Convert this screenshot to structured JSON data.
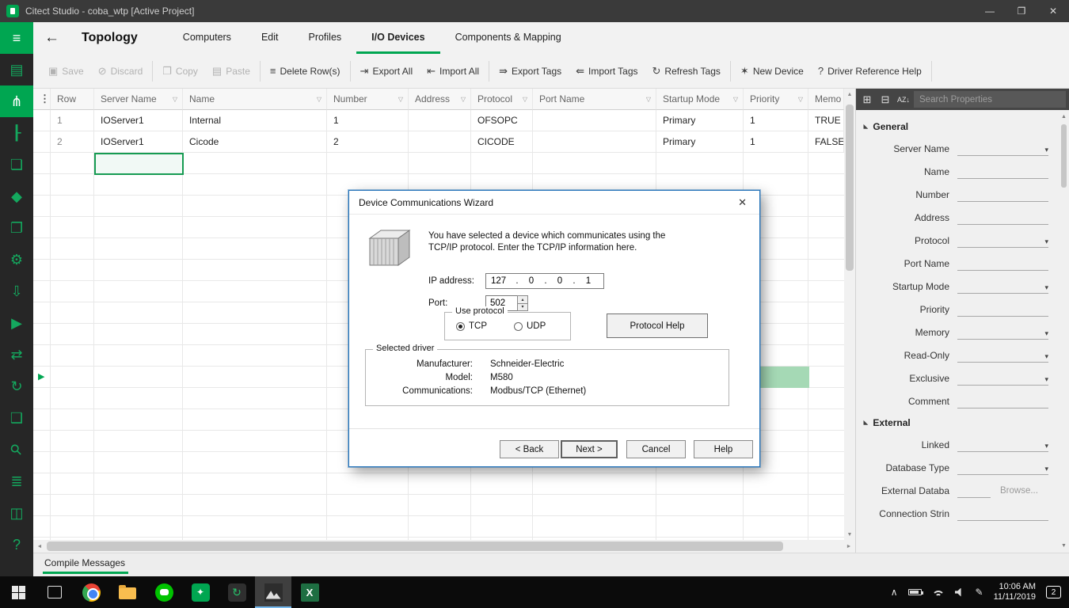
{
  "window": {
    "title": "Citect Studio - coba_wtp [Active Project]"
  },
  "nav": {
    "title": "Topology",
    "tabs": [
      "Computers",
      "Edit",
      "Profiles",
      "I/O Devices",
      "Components & Mapping"
    ]
  },
  "toolbar": {
    "items": [
      "Save",
      "Discard",
      "Copy",
      "Paste",
      "Delete Row(s)",
      "Export All",
      "Import All",
      "Export Tags",
      "Import Tags",
      "Refresh Tags",
      "New Device",
      "Driver Reference Help"
    ]
  },
  "table": {
    "headers": [
      "Row",
      "Server Name",
      "Name",
      "Number",
      "Address",
      "Protocol",
      "Port Name",
      "Startup Mode",
      "Priority",
      "Memo"
    ],
    "rows": [
      [
        "1",
        "IOServer1",
        "Internal",
        "1",
        "",
        "OFSOPC",
        "",
        "Primary",
        "1",
        "TRUE"
      ],
      [
        "2",
        "IOServer1",
        "Cicode",
        "2",
        "",
        "CICODE",
        "",
        "Primary",
        "1",
        "FALSE"
      ]
    ]
  },
  "properties": {
    "search_placeholder": "Search Properties",
    "general_title": "General",
    "general_fields": [
      "Server Name",
      "Name",
      "Number",
      "Address",
      "Protocol",
      "Port Name",
      "Startup Mode",
      "Priority",
      "Memory",
      "Read-Only",
      "Exclusive",
      "Comment"
    ],
    "external_title": "External",
    "external_fields": [
      "Linked",
      "Database Type",
      "External Databa",
      "Connection Strin"
    ],
    "browse_label": "Browse..."
  },
  "dialog": {
    "title": "Device Communications Wizard",
    "message_1": "You have selected a device which communicates using the",
    "message_2": "TCP/IP protocol. Enter the TCP/IP information here.",
    "ip_label": "IP address:",
    "ip_parts": [
      "127",
      "0",
      "0",
      "1"
    ],
    "ip_separator": ".",
    "port_label": "Port:",
    "port_value": "502",
    "protocol_group": "Use protocol",
    "tcp_label": "TCP",
    "udp_label": "UDP",
    "protocol_help": "Protocol Help",
    "driver_group": "Selected driver",
    "manufacturer_label": "Manufacturer:",
    "manufacturer_value": "Schneider-Electric",
    "model_label": "Model:",
    "model_value": "M580",
    "communications_label": "Communications:",
    "communications_value": "Modbus/TCP (Ethernet)",
    "back": "< Back",
    "next": "Next >",
    "cancel": "Cancel",
    "help": "Help"
  },
  "statusbar": {
    "tab": "Compile Messages"
  },
  "taskbar": {
    "time": "10:06 AM",
    "date": "11/11/2019",
    "badge": "2"
  },
  "icons": {
    "menu": "≡",
    "stack": "▤",
    "topology": "⋔",
    "tree": "┠",
    "monitor": "❏",
    "shield": "◆",
    "documents": "❐",
    "gear": "⚙",
    "download": "⇩",
    "play": "▶",
    "swap": "⇄",
    "deploy": "↻",
    "page": "❑",
    "search": "⚲",
    "list": "≣",
    "panel": "◫",
    "help": "?",
    "back": "←",
    "save": "▣",
    "discard": "⊘",
    "copy": "❐",
    "paste": "▤",
    "delete_rows": "≡",
    "export_all": "⇥",
    "import_all": "⇤",
    "export_tags": "⇛",
    "import_tags": "⇚",
    "refresh": "↻",
    "new_device": "✶",
    "driver_help": "?",
    "funnel": "▽",
    "kebab": "⋮",
    "grid_plus": "⊞",
    "grid_minus": "⊟",
    "sort_az": "AZ↓",
    "chevron_down": "▾",
    "spin_up": "▴",
    "spin_down": "▾",
    "minimize": "—",
    "restore": "❐",
    "close": "✕",
    "section_marker": "◢",
    "row_marker": "▶",
    "scroll_up": "▲",
    "scroll_down": "▼",
    "scroll_left": "◄",
    "scroll_right": "►",
    "tray_caret": "∧",
    "pen": "✎"
  }
}
